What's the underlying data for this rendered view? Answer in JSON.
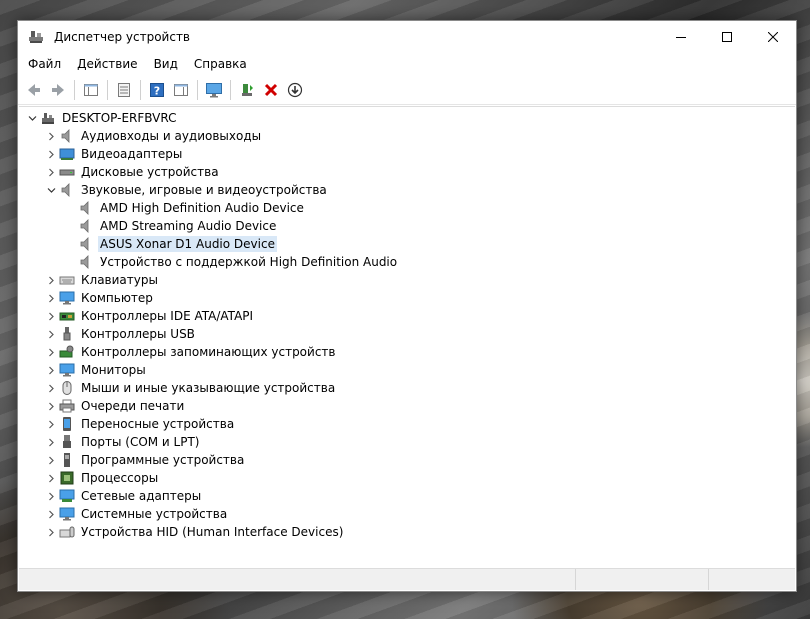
{
  "window": {
    "title": "Диспетчер устройств"
  },
  "menu": [
    {
      "label": "Файл"
    },
    {
      "label": "Действие"
    },
    {
      "label": "Вид"
    },
    {
      "label": "Справка"
    }
  ],
  "toolbar": {
    "buttons": [
      "back-icon",
      "forward-icon",
      "properties-icon",
      "list-icon",
      "help-icon",
      "action-icon",
      "monitor-icon",
      "update-driver-icon",
      "uninstall-icon",
      "download-icon"
    ]
  },
  "tree": {
    "root": "DESKTOP-ERFBVRC",
    "categories": [
      {
        "label": "Аудиовходы и аудиовыходы",
        "icon": "speaker-icon"
      },
      {
        "label": "Видеоадаптеры",
        "icon": "display-adapter-icon"
      },
      {
        "label": "Дисковые устройства",
        "icon": "disk-icon"
      },
      {
        "label": "Звуковые, игровые и видеоустройства",
        "icon": "speaker-icon",
        "expanded": true,
        "children": [
          {
            "label": "AMD High Definition Audio Device"
          },
          {
            "label": "AMD Streaming Audio Device"
          },
          {
            "label": "ASUS Xonar D1 Audio Device",
            "selected": true
          },
          {
            "label": "Устройство с поддержкой High Definition Audio"
          }
        ]
      },
      {
        "label": "Клавиатуры",
        "icon": "keyboard-icon"
      },
      {
        "label": "Компьютер",
        "icon": "computer-icon"
      },
      {
        "label": "Контроллеры IDE ATA/ATAPI",
        "icon": "ide-controller-icon"
      },
      {
        "label": "Контроллеры USB",
        "icon": "usb-icon"
      },
      {
        "label": "Контроллеры запоминающих устройств",
        "icon": "storage-controller-icon"
      },
      {
        "label": "Мониторы",
        "icon": "monitor-icon"
      },
      {
        "label": "Мыши и иные указывающие устройства",
        "icon": "mouse-icon"
      },
      {
        "label": "Очереди печати",
        "icon": "printer-icon"
      },
      {
        "label": "Переносные устройства",
        "icon": "portable-device-icon"
      },
      {
        "label": "Порты (COM и LPT)",
        "icon": "port-icon"
      },
      {
        "label": "Программные устройства",
        "icon": "software-device-icon"
      },
      {
        "label": "Процессоры",
        "icon": "processor-icon"
      },
      {
        "label": "Сетевые адаптеры",
        "icon": "network-adapter-icon"
      },
      {
        "label": "Системные устройства",
        "icon": "system-device-icon"
      },
      {
        "label": "Устройства HID (Human Interface Devices)",
        "icon": "hid-icon"
      }
    ]
  },
  "colors": {
    "selection": "#d9e8f7",
    "uninstall_red": "#d00000",
    "accent_blue": "#1f6fc6"
  }
}
